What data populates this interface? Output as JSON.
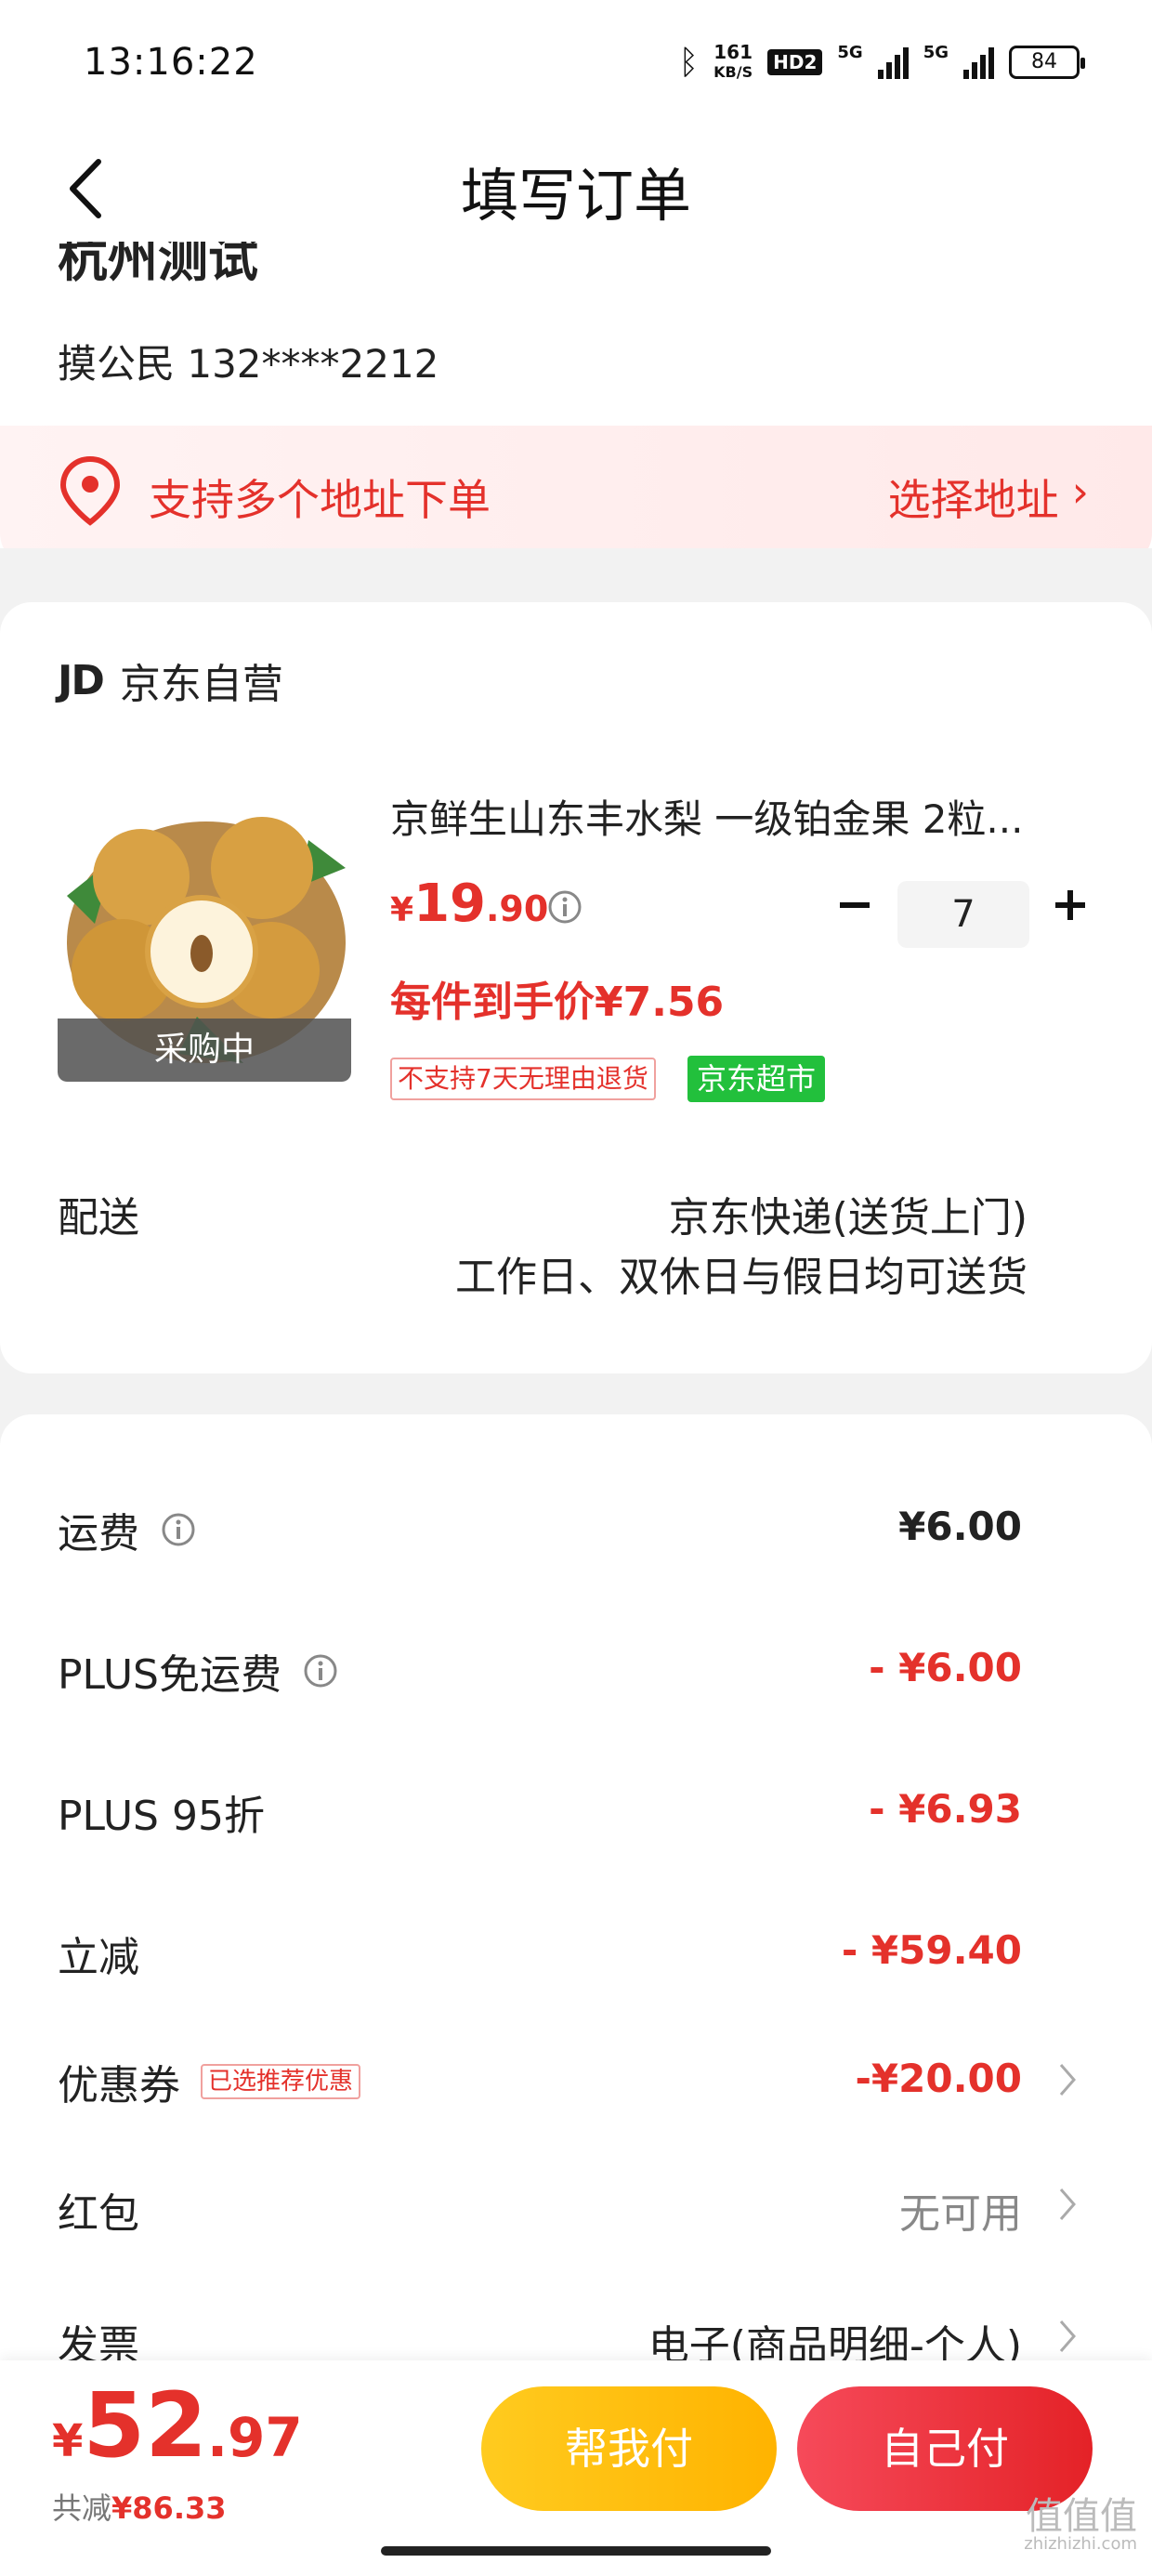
{
  "status_bar": {
    "time": "13:16:22",
    "net_speed": "161",
    "net_unit": "KB/S",
    "hd_label": "HD2",
    "sim1_label": "5G",
    "sim2_label": "5G",
    "battery": "84"
  },
  "nav": {
    "title": "填写订单"
  },
  "address": {
    "city": "杭州测试",
    "person": "摸公民  132****2212",
    "multi_address_text": "支持多个地址下单",
    "choose_address_label": "选择地址",
    "chevron": "›"
  },
  "shop": {
    "logo": "JD",
    "name": "京东自营"
  },
  "product": {
    "image_tag": "采购中",
    "title": "京鲜生山东丰水梨 一级铂金果 2粒...",
    "price_currency": "¥",
    "price_int": "19",
    "price_dec": ".90",
    "quantity": "7",
    "unit_price": "每件到手价¥7.56",
    "tag_no_return": "不支持7天无理由退货",
    "tag_market": "京东超市"
  },
  "delivery": {
    "label": "配送",
    "method": "京东快递(送货上门)",
    "time": "工作日、双休日与假日均可送货"
  },
  "fees": {
    "shipping_label": "运费",
    "shipping_value": "¥6.00",
    "plus_free_label": "PLUS免运费",
    "plus_free_value": "- ¥6.00",
    "plus_discount_label": "PLUS 95折",
    "plus_discount_value": "- ¥6.93",
    "instant_label": "立减",
    "instant_value": "- ¥59.40",
    "coupon_label": "优惠券",
    "coupon_badge": "已选推荐优惠",
    "coupon_value": "-¥20.00",
    "redpacket_label": "红包",
    "redpacket_value": "无可用",
    "invoice_label": "发票",
    "invoice_value": "电子(商品明细-个人)"
  },
  "bottom": {
    "total_currency": "¥",
    "total_int": "52",
    "total_dec": ".97",
    "saved_label": "共减",
    "saved_value": "¥86.33",
    "help_pay_label": "帮我付",
    "self_pay_label": "自己付"
  },
  "watermark": {
    "text": "值值值",
    "sub": "zhizhizhi.com"
  },
  "colors": {
    "accent": "#e4312b",
    "help_button": "#ffb300",
    "self_button": "#e42227",
    "market_tag": "#22c03c"
  },
  "icons": {
    "back": "chevron-left-icon",
    "location": "location-pin-icon",
    "info": "info-circle-icon",
    "minus": "minus-icon",
    "plus": "plus-icon",
    "chevron": "chevron-right-icon"
  }
}
